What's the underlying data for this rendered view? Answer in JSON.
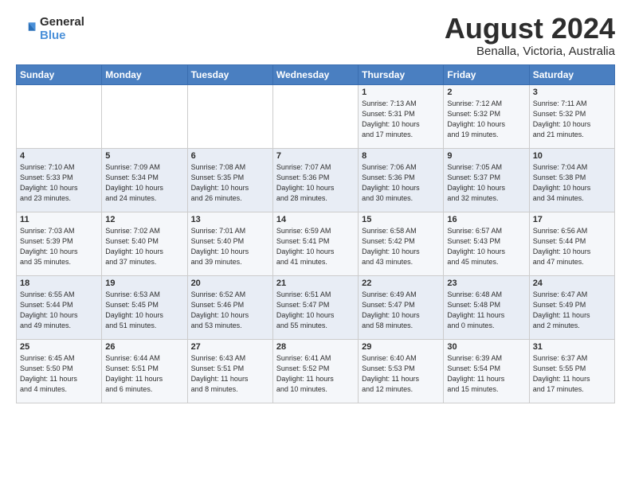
{
  "logo": {
    "line1": "General",
    "line2": "Blue"
  },
  "title": "August 2024",
  "subtitle": "Benalla, Victoria, Australia",
  "days_of_week": [
    "Sunday",
    "Monday",
    "Tuesday",
    "Wednesday",
    "Thursday",
    "Friday",
    "Saturday"
  ],
  "weeks": [
    [
      {
        "day": "",
        "info": ""
      },
      {
        "day": "",
        "info": ""
      },
      {
        "day": "",
        "info": ""
      },
      {
        "day": "",
        "info": ""
      },
      {
        "day": "1",
        "info": "Sunrise: 7:13 AM\nSunset: 5:31 PM\nDaylight: 10 hours\nand 17 minutes."
      },
      {
        "day": "2",
        "info": "Sunrise: 7:12 AM\nSunset: 5:32 PM\nDaylight: 10 hours\nand 19 minutes."
      },
      {
        "day": "3",
        "info": "Sunrise: 7:11 AM\nSunset: 5:32 PM\nDaylight: 10 hours\nand 21 minutes."
      }
    ],
    [
      {
        "day": "4",
        "info": "Sunrise: 7:10 AM\nSunset: 5:33 PM\nDaylight: 10 hours\nand 23 minutes."
      },
      {
        "day": "5",
        "info": "Sunrise: 7:09 AM\nSunset: 5:34 PM\nDaylight: 10 hours\nand 24 minutes."
      },
      {
        "day": "6",
        "info": "Sunrise: 7:08 AM\nSunset: 5:35 PM\nDaylight: 10 hours\nand 26 minutes."
      },
      {
        "day": "7",
        "info": "Sunrise: 7:07 AM\nSunset: 5:36 PM\nDaylight: 10 hours\nand 28 minutes."
      },
      {
        "day": "8",
        "info": "Sunrise: 7:06 AM\nSunset: 5:36 PM\nDaylight: 10 hours\nand 30 minutes."
      },
      {
        "day": "9",
        "info": "Sunrise: 7:05 AM\nSunset: 5:37 PM\nDaylight: 10 hours\nand 32 minutes."
      },
      {
        "day": "10",
        "info": "Sunrise: 7:04 AM\nSunset: 5:38 PM\nDaylight: 10 hours\nand 34 minutes."
      }
    ],
    [
      {
        "day": "11",
        "info": "Sunrise: 7:03 AM\nSunset: 5:39 PM\nDaylight: 10 hours\nand 35 minutes."
      },
      {
        "day": "12",
        "info": "Sunrise: 7:02 AM\nSunset: 5:40 PM\nDaylight: 10 hours\nand 37 minutes."
      },
      {
        "day": "13",
        "info": "Sunrise: 7:01 AM\nSunset: 5:40 PM\nDaylight: 10 hours\nand 39 minutes."
      },
      {
        "day": "14",
        "info": "Sunrise: 6:59 AM\nSunset: 5:41 PM\nDaylight: 10 hours\nand 41 minutes."
      },
      {
        "day": "15",
        "info": "Sunrise: 6:58 AM\nSunset: 5:42 PM\nDaylight: 10 hours\nand 43 minutes."
      },
      {
        "day": "16",
        "info": "Sunrise: 6:57 AM\nSunset: 5:43 PM\nDaylight: 10 hours\nand 45 minutes."
      },
      {
        "day": "17",
        "info": "Sunrise: 6:56 AM\nSunset: 5:44 PM\nDaylight: 10 hours\nand 47 minutes."
      }
    ],
    [
      {
        "day": "18",
        "info": "Sunrise: 6:55 AM\nSunset: 5:44 PM\nDaylight: 10 hours\nand 49 minutes."
      },
      {
        "day": "19",
        "info": "Sunrise: 6:53 AM\nSunset: 5:45 PM\nDaylight: 10 hours\nand 51 minutes."
      },
      {
        "day": "20",
        "info": "Sunrise: 6:52 AM\nSunset: 5:46 PM\nDaylight: 10 hours\nand 53 minutes."
      },
      {
        "day": "21",
        "info": "Sunrise: 6:51 AM\nSunset: 5:47 PM\nDaylight: 10 hours\nand 55 minutes."
      },
      {
        "day": "22",
        "info": "Sunrise: 6:49 AM\nSunset: 5:47 PM\nDaylight: 10 hours\nand 58 minutes."
      },
      {
        "day": "23",
        "info": "Sunrise: 6:48 AM\nSunset: 5:48 PM\nDaylight: 11 hours\nand 0 minutes."
      },
      {
        "day": "24",
        "info": "Sunrise: 6:47 AM\nSunset: 5:49 PM\nDaylight: 11 hours\nand 2 minutes."
      }
    ],
    [
      {
        "day": "25",
        "info": "Sunrise: 6:45 AM\nSunset: 5:50 PM\nDaylight: 11 hours\nand 4 minutes."
      },
      {
        "day": "26",
        "info": "Sunrise: 6:44 AM\nSunset: 5:51 PM\nDaylight: 11 hours\nand 6 minutes."
      },
      {
        "day": "27",
        "info": "Sunrise: 6:43 AM\nSunset: 5:51 PM\nDaylight: 11 hours\nand 8 minutes."
      },
      {
        "day": "28",
        "info": "Sunrise: 6:41 AM\nSunset: 5:52 PM\nDaylight: 11 hours\nand 10 minutes."
      },
      {
        "day": "29",
        "info": "Sunrise: 6:40 AM\nSunset: 5:53 PM\nDaylight: 11 hours\nand 12 minutes."
      },
      {
        "day": "30",
        "info": "Sunrise: 6:39 AM\nSunset: 5:54 PM\nDaylight: 11 hours\nand 15 minutes."
      },
      {
        "day": "31",
        "info": "Sunrise: 6:37 AM\nSunset: 5:55 PM\nDaylight: 11 hours\nand 17 minutes."
      }
    ]
  ]
}
